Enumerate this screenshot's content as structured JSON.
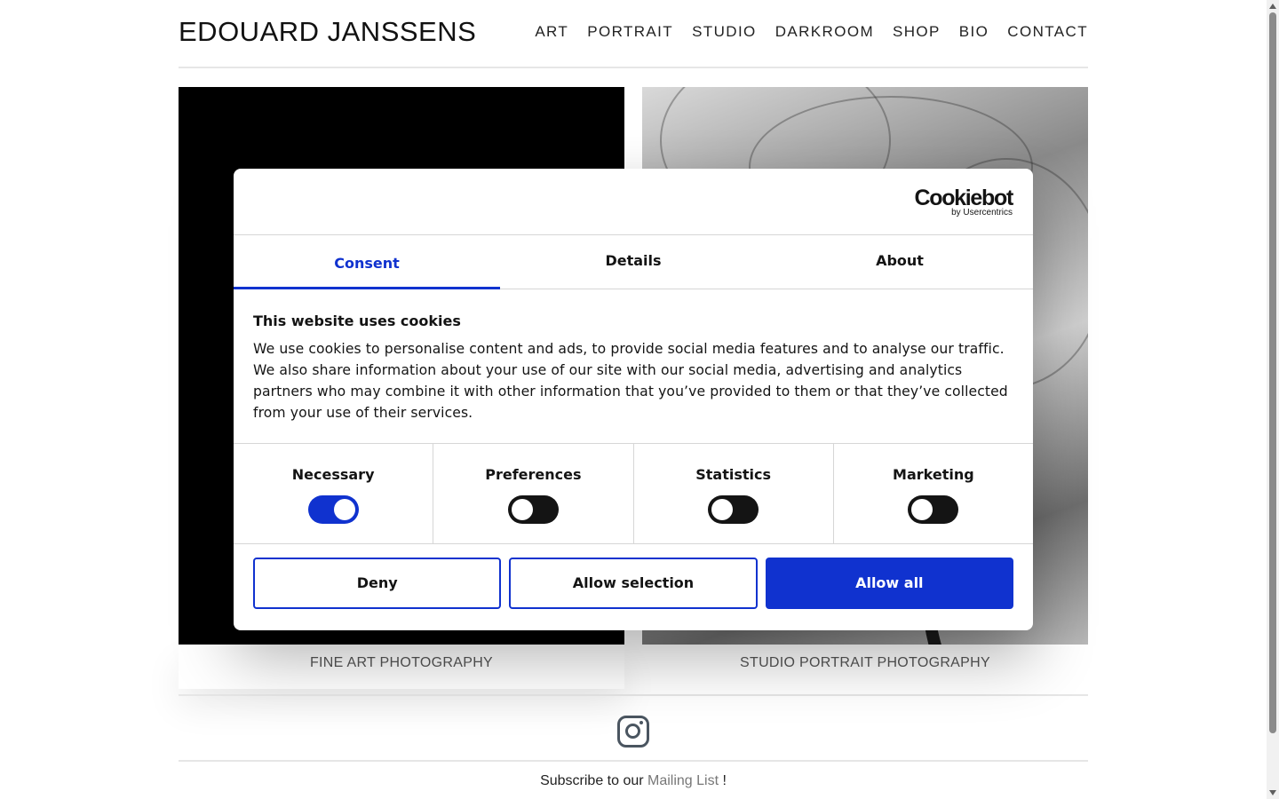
{
  "site": {
    "brand": "EDOUARD JANSSENS",
    "nav": [
      "ART",
      "PORTRAIT",
      "STUDIO",
      "DARKROOM",
      "SHOP",
      "BIO",
      "CONTACT"
    ]
  },
  "gallery": {
    "captions": [
      "FINE ART PHOTOGRAPHY",
      "STUDIO PORTRAIT PHOTOGRAPHY"
    ]
  },
  "footer": {
    "subscribe_prefix": "Subscribe to our ",
    "subscribe_link": "Mailing List",
    "subscribe_suffix": " !",
    "icons": [
      "instagram-icon"
    ]
  },
  "cookie_dialog": {
    "logo_main": "Cookiebot",
    "logo_sub": "by Usercentrics",
    "tabs": [
      {
        "label": "Consent",
        "active": true
      },
      {
        "label": "Details",
        "active": false
      },
      {
        "label": "About",
        "active": false
      }
    ],
    "title": "This website uses cookies",
    "text": "We use cookies to personalise content and ads, to provide social media features and to analyse our traffic. We also share information about your use of our site with our social media, advertising and analytics partners who may combine it with other information that you’ve provided to them or that they’ve collected from your use of their services.",
    "toggles": [
      {
        "label": "Necessary",
        "on": true
      },
      {
        "label": "Preferences",
        "on": false
      },
      {
        "label": "Statistics",
        "on": false
      },
      {
        "label": "Marketing",
        "on": false
      }
    ],
    "buttons": {
      "deny": "Deny",
      "allow_selection": "Allow selection",
      "allow_all": "Allow all"
    },
    "accent_color": "#1032cf"
  }
}
